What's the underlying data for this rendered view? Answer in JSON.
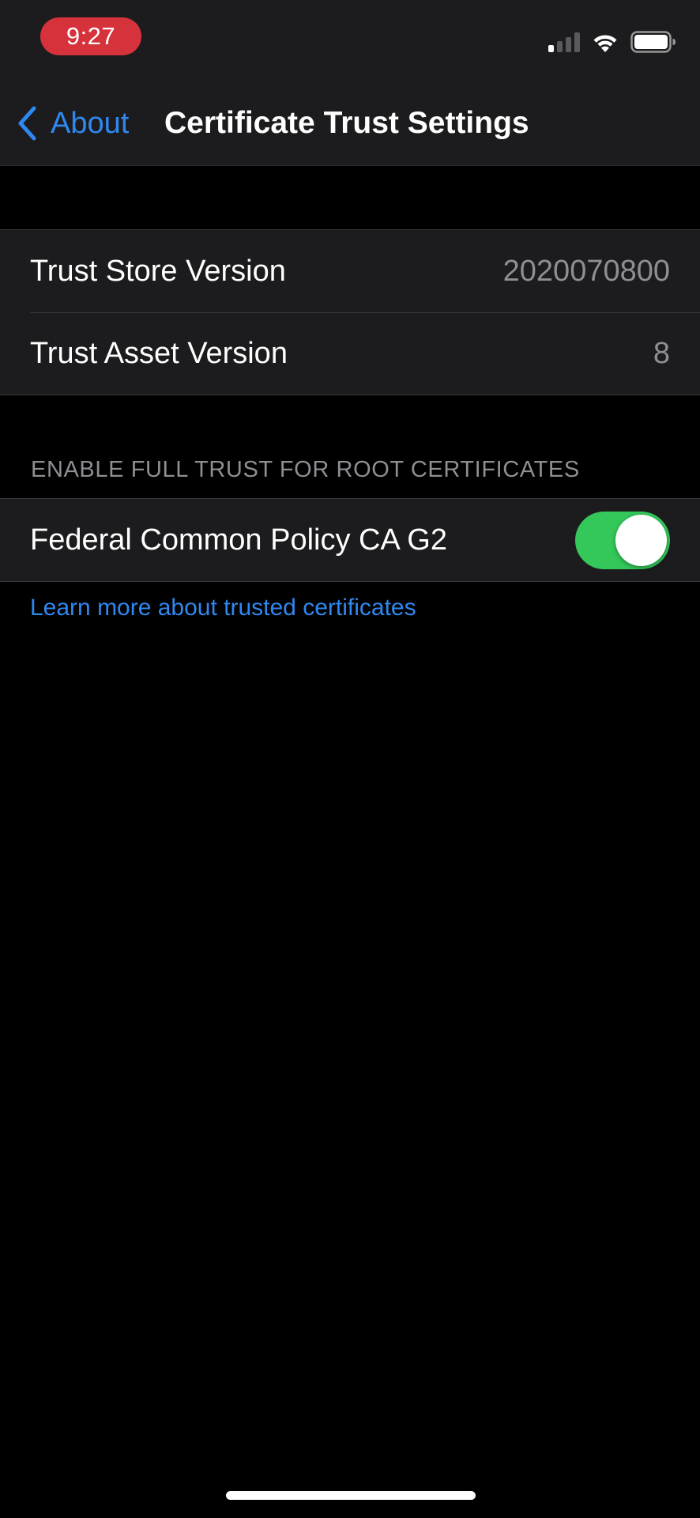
{
  "status_bar": {
    "time": "9:27",
    "icons": [
      "cellular-signal-icon",
      "wifi-icon",
      "battery-icon"
    ]
  },
  "nav": {
    "back_label": "About",
    "title": "Certificate Trust Settings"
  },
  "versions": [
    {
      "label": "Trust Store Version",
      "value": "2020070800"
    },
    {
      "label": "Trust Asset Version",
      "value": "8"
    }
  ],
  "root_trust": {
    "header": "ENABLE FULL TRUST FOR ROOT CERTIFICATES",
    "items": [
      {
        "label": "Federal Common Policy CA G2",
        "enabled": true
      }
    ]
  },
  "learn_more_link": "Learn more about trusted certificates",
  "colors": {
    "accent": "#2f88f0",
    "toggle_on": "#34c759",
    "time_pill": "#d6323c",
    "background": "#000000",
    "cell": "#1c1c1e",
    "secondary_text": "#8e8e93"
  }
}
